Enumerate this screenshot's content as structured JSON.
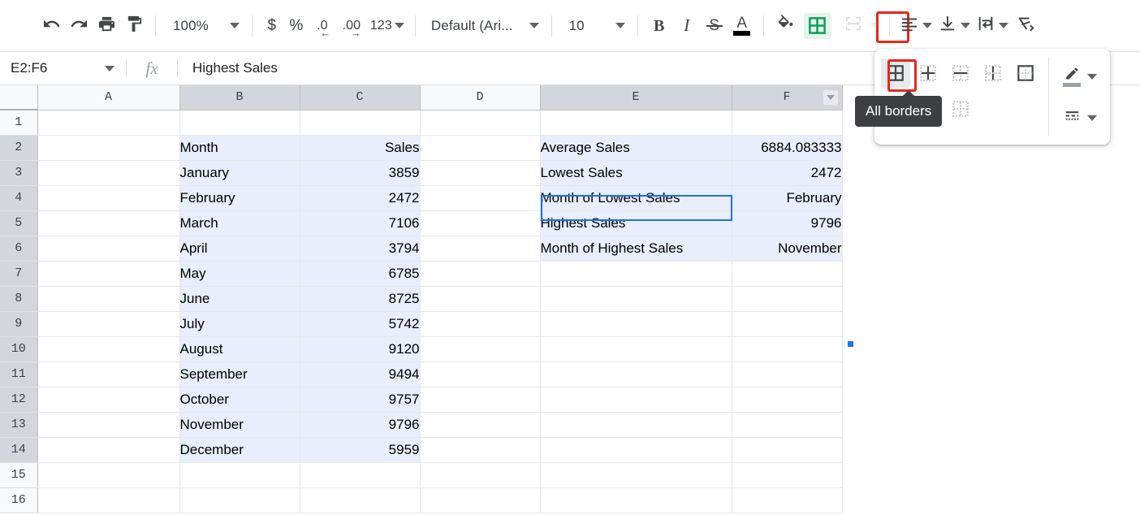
{
  "toolbar": {
    "undo_icon": "undo-icon",
    "redo_icon": "redo-icon",
    "print_icon": "print-icon",
    "paint_format_icon": "paint-format-icon",
    "zoom_value": "100%",
    "currency_label": "$",
    "percent_label": "%",
    "decrease_decimal_label": ".0",
    "increase_decimal_label": ".00",
    "number_format_label": "123",
    "font_value": "Default (Ari...",
    "font_size_value": "10",
    "bold_label": "B",
    "italic_label": "I",
    "strikethrough_label": "S",
    "text_color_label": "A",
    "fill_color_icon": "fill-color-icon",
    "borders_icon": "borders-icon",
    "merge_cells_icon": "merge-cells-icon",
    "horizontal_align_icon": "horizontal-align-icon",
    "vertical_align_icon": "vertical-align-icon",
    "text_wrap_icon": "text-wrap-icon",
    "text_rotation_icon": "text-rotation-icon",
    "accent_highlight": "#e6f4ea",
    "annotation_color": "#e8271c"
  },
  "borders_menu": {
    "tooltip": "All borders",
    "items": [
      "all-borders",
      "inner-borders",
      "horizontal-borders",
      "vertical-borders",
      "outer-borders",
      "left-border",
      "bottom-border",
      "clear-borders"
    ],
    "border_color_icon": "pencil-icon",
    "border_style_icon": "line-style-icon",
    "selected": "all-borders"
  },
  "formula_bar": {
    "name_box": "E2:F6",
    "fx_label": "fx",
    "value": "Highest Sales"
  },
  "grid": {
    "columns": [
      "A",
      "B",
      "C",
      "D",
      "E",
      "F"
    ],
    "selected_columns": [
      "B",
      "C",
      "E",
      "F"
    ],
    "column_filter_on": "F",
    "rows": [
      "1",
      "2",
      "3",
      "4",
      "5",
      "6",
      "7",
      "8",
      "9",
      "10",
      "11",
      "12",
      "13",
      "14",
      "15",
      "16"
    ],
    "selected_rows": [
      "2",
      "3",
      "4",
      "5",
      "6",
      "7",
      "8",
      "9",
      "10",
      "11",
      "12",
      "13",
      "14"
    ],
    "selection_fill": "#e8eefc",
    "active_cell_color": "#1a73e8"
  },
  "sales_table": {
    "headers": {
      "month": "Month",
      "sales": "Sales"
    },
    "rows": [
      {
        "month": "January",
        "sales": "3859"
      },
      {
        "month": "February",
        "sales": "2472"
      },
      {
        "month": "March",
        "sales": "7106"
      },
      {
        "month": "April",
        "sales": "3794"
      },
      {
        "month": "May",
        "sales": "6785"
      },
      {
        "month": "June",
        "sales": "8725"
      },
      {
        "month": "July",
        "sales": "5742"
      },
      {
        "month": "August",
        "sales": "9120"
      },
      {
        "month": "September",
        "sales": "9494"
      },
      {
        "month": "October",
        "sales": "9757"
      },
      {
        "month": "November",
        "sales": "9796"
      },
      {
        "month": "December",
        "sales": "5959"
      }
    ]
  },
  "summary_table": {
    "rows": [
      {
        "label": "Average Sales",
        "value": "6884.083333"
      },
      {
        "label": "Lowest Sales",
        "value": "2472"
      },
      {
        "label": "Month of Lowest Sales",
        "value": "February"
      },
      {
        "label": "Highest Sales",
        "value": "9796"
      },
      {
        "label": "Month of Highest Sales",
        "value": "November"
      }
    ],
    "active_label": "Highest Sales"
  }
}
